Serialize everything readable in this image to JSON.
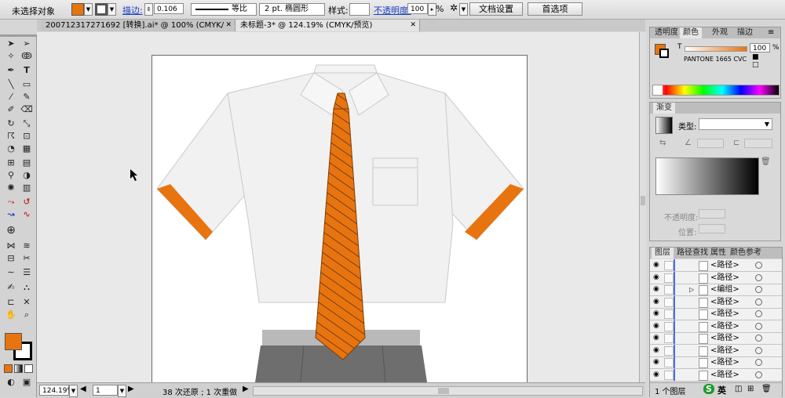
{
  "control_bar": {
    "selection_status": "未选择对象",
    "stroke_label": "描边:",
    "stroke_weight": "0.106",
    "profile_label": "等比",
    "brush_label": "2 pt. 椭圆形",
    "style_label": "样式:",
    "opacity_label": "不透明度:",
    "opacity_value": "100",
    "opacity_unit": "%",
    "doc_setup_button": "文档设置",
    "prefs_button": "首选项",
    "fill_color": "#e8740f",
    "stroke_color": "#000000"
  },
  "doc_tabs": [
    {
      "label": "200712317271692 [转换].ai* @ 100% (CMYK/预览)"
    },
    {
      "label": "未标题-3* @ 124.19% (CMYK/预览)"
    }
  ],
  "status_bar": {
    "zoom": "124.19%",
    "page": "1",
    "undo_text": "38 次还原 ; 1 次重做"
  },
  "color_panel": {
    "tabs": [
      "透明度",
      "颜色",
      "外观",
      "描边"
    ],
    "t_label": "T",
    "tint_value": "100",
    "tint_unit": "%",
    "swatch_name": "PANTONE 1665 CVC"
  },
  "gradient_panel": {
    "title": "渐变",
    "type_label": "类型:",
    "opacity_label": "不透明度:",
    "position_label": "位置:"
  },
  "layers_panel": {
    "tabs": [
      "图层",
      "路径查找",
      "属性",
      "颜色参考"
    ],
    "rows": [
      "<路径>",
      "<路径>",
      "<编组>",
      "<路径>",
      "<路径>",
      "<路径>",
      "<路径>",
      "<路径>",
      "<路径>",
      "<路径>"
    ],
    "footer": "1 个图层"
  },
  "watermark_text": "英",
  "colors": {
    "accent": "#e8740f",
    "shirt": "#f1f1f1",
    "shirt_line": "#c9c9c9",
    "pants": "#6e6e6e",
    "belt": "#b9b9b9"
  }
}
